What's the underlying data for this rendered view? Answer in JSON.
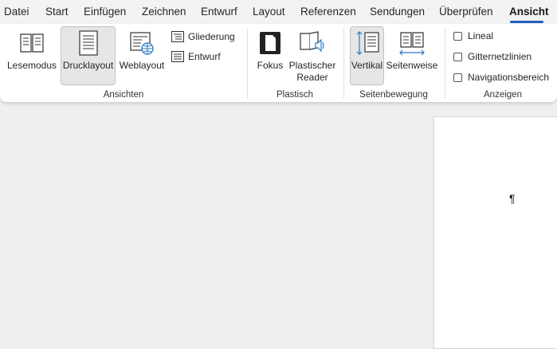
{
  "tabs": [
    {
      "label": "Datei",
      "active": false
    },
    {
      "label": "Start",
      "active": false
    },
    {
      "label": "Einfügen",
      "active": false
    },
    {
      "label": "Zeichnen",
      "active": false
    },
    {
      "label": "Entwurf",
      "active": false
    },
    {
      "label": "Layout",
      "active": false
    },
    {
      "label": "Referenzen",
      "active": false
    },
    {
      "label": "Sendungen",
      "active": false
    },
    {
      "label": "Überprüfen",
      "active": false
    },
    {
      "label": "Ansicht",
      "active": true
    }
  ],
  "ribbon": {
    "ansichten": {
      "group_label": "Ansichten",
      "lesemodus": "Lesemodus",
      "drucklayout": "Drucklayout",
      "weblayout": "Weblayout",
      "gliederung": "Gliederung",
      "entwurf": "Entwurf"
    },
    "plastisch": {
      "group_label": "Plastisch",
      "fokus": "Fokus",
      "reader_line1": "Plastischer",
      "reader_line2": "Reader"
    },
    "seitenbewegung": {
      "group_label": "Seitenbewegung",
      "vertikal": "Vertikal",
      "seitenweise": "Seitenweise"
    },
    "anzeigen": {
      "group_label": "Anzeigen",
      "lineal": "Lineal",
      "lineal_checked": false,
      "gitternetzlinien": "Gitternetzlinien",
      "gitternetzlinien_checked": false,
      "navigationsbereich": "Navigationsbereich",
      "navigationsbereich_checked": false
    }
  },
  "document": {
    "paragraph_mark": "¶"
  },
  "colors": {
    "accent": "#1f5fbf",
    "blue_icon": "#2b79c2"
  }
}
